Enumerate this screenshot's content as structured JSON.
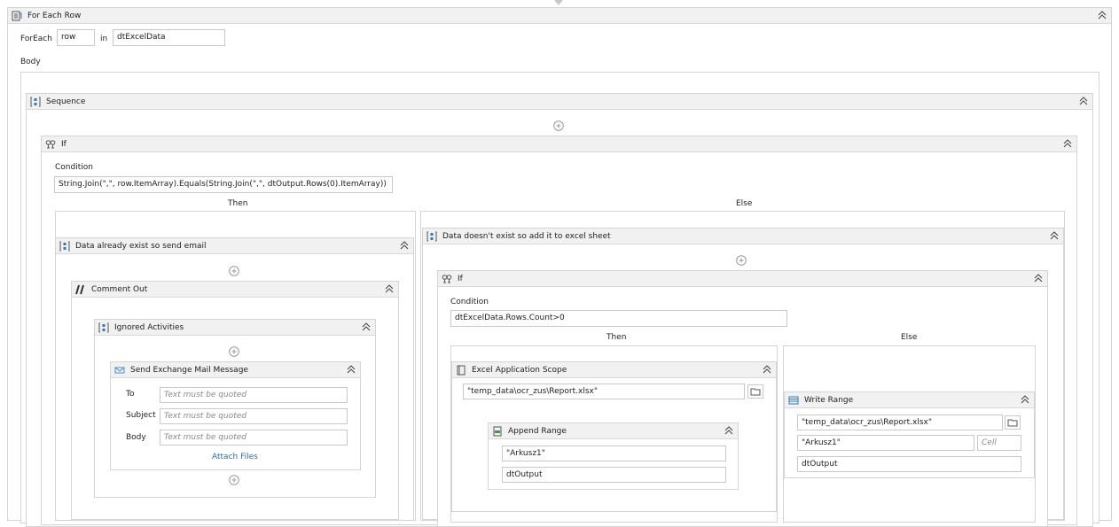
{
  "foreach": {
    "title": "For Each Row",
    "foreach_label": "ForEach",
    "item": "row",
    "in_label": "in",
    "collection": "dtExcelData",
    "body_label": "Body"
  },
  "sequence": {
    "title": "Sequence"
  },
  "if_outer": {
    "title": "If",
    "condition_label": "Condition",
    "condition": "String.Join(\",\", row.ItemArray).Equals(String.Join(\",\", dtOutput.Rows(0).ItemArray))",
    "then_label": "Then",
    "else_label": "Else"
  },
  "then_seq": {
    "title": "Data already exist so send email"
  },
  "comment_out": {
    "title": "Comment Out"
  },
  "ignored": {
    "title": "Ignored Activities"
  },
  "mail": {
    "title": "Send Exchange Mail Message",
    "to_label": "To",
    "subject_label": "Subject",
    "body_label": "Body",
    "placeholder": "Text must be quoted",
    "attach_label": "Attach Files"
  },
  "else_seq": {
    "title": "Data doesn't exist so add it to excel sheet"
  },
  "if_inner": {
    "title": "If",
    "condition_label": "Condition",
    "condition": "dtExcelData.Rows.Count>0",
    "then_label": "Then",
    "else_label": "Else"
  },
  "excel_scope": {
    "title": "Excel Application Scope",
    "path": "\"temp_data\\ocr_zus\\Report.xlsx\""
  },
  "append": {
    "title": "Append Range",
    "sheet": "\"Arkusz1\"",
    "table": "dtOutput"
  },
  "write": {
    "title": "Write Range",
    "path": "\"temp_data\\ocr_zus\\Report.xlsx\"",
    "sheet": "\"Arkusz1\"",
    "cell_placeholder": "Cell",
    "table": "dtOutput"
  },
  "colors": {
    "header_bg": "#f1f1f1",
    "border": "#d5d5d5",
    "accent": "#2f78c4",
    "link": "#2b6cb0"
  }
}
